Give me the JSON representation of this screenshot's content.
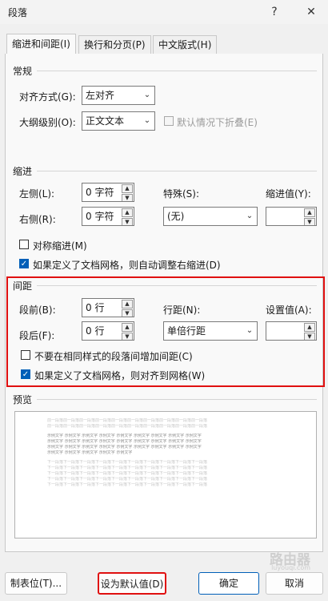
{
  "window": {
    "title": "段落",
    "help": "?",
    "close": "✕"
  },
  "tabs": [
    {
      "label": "缩进和间距(I)"
    },
    {
      "label": "换行和分页(P)"
    },
    {
      "label": "中文版式(H)"
    }
  ],
  "general": {
    "heading": "常规",
    "alignment_label": "对齐方式(G):",
    "alignment_value": "左对齐",
    "outline_label": "大纲级别(O):",
    "outline_value": "正文文本",
    "collapse_label": "默认情况下折叠(E)"
  },
  "indent": {
    "heading": "缩进",
    "left_label": "左侧(L):",
    "left_value": "0 字符",
    "right_label": "右侧(R):",
    "right_value": "0 字符",
    "special_label": "特殊(S):",
    "special_value": "(无)",
    "amount_label": "缩进值(Y):",
    "amount_value": "",
    "mirror_label": "对称缩进(M)",
    "grid_label": "如果定义了文档网格，则自动调整右缩进(D)"
  },
  "spacing": {
    "heading": "间距",
    "before_label": "段前(B):",
    "before_value": "0 行",
    "after_label": "段后(F):",
    "after_value": "0 行",
    "line_label": "行距(N):",
    "line_value": "单倍行距",
    "at_label": "设置值(A):",
    "at_value": "",
    "nospace_label": "不要在相同样式的段落间增加间距(C)",
    "snap_label": "如果定义了文档网格，则对齐到网格(W)"
  },
  "preview": {
    "heading": "预览",
    "prev_text": "前一段落前一段落前一段落前一段落前一段落前一段落前一段落前一段落前一段落前一段落",
    "sample_text": "示例文字 示例文字 示例文字 示例文字 示例文字 示例文字 示例文字 示例文字 示例文字",
    "sample_last": "示例文字 示例文字 示例文字 示例文字 示例文字",
    "next_text": "下一段落下一段落下一段落下一段落下一段落下一段落下一段落下一段落下一段落下一段落"
  },
  "buttons": {
    "tabs": "制表位(T)...",
    "default": "设为默认值(D)",
    "ok": "确定",
    "cancel": "取消"
  },
  "watermark": {
    "text": "路由器",
    "sub": "luyouqi.com"
  }
}
